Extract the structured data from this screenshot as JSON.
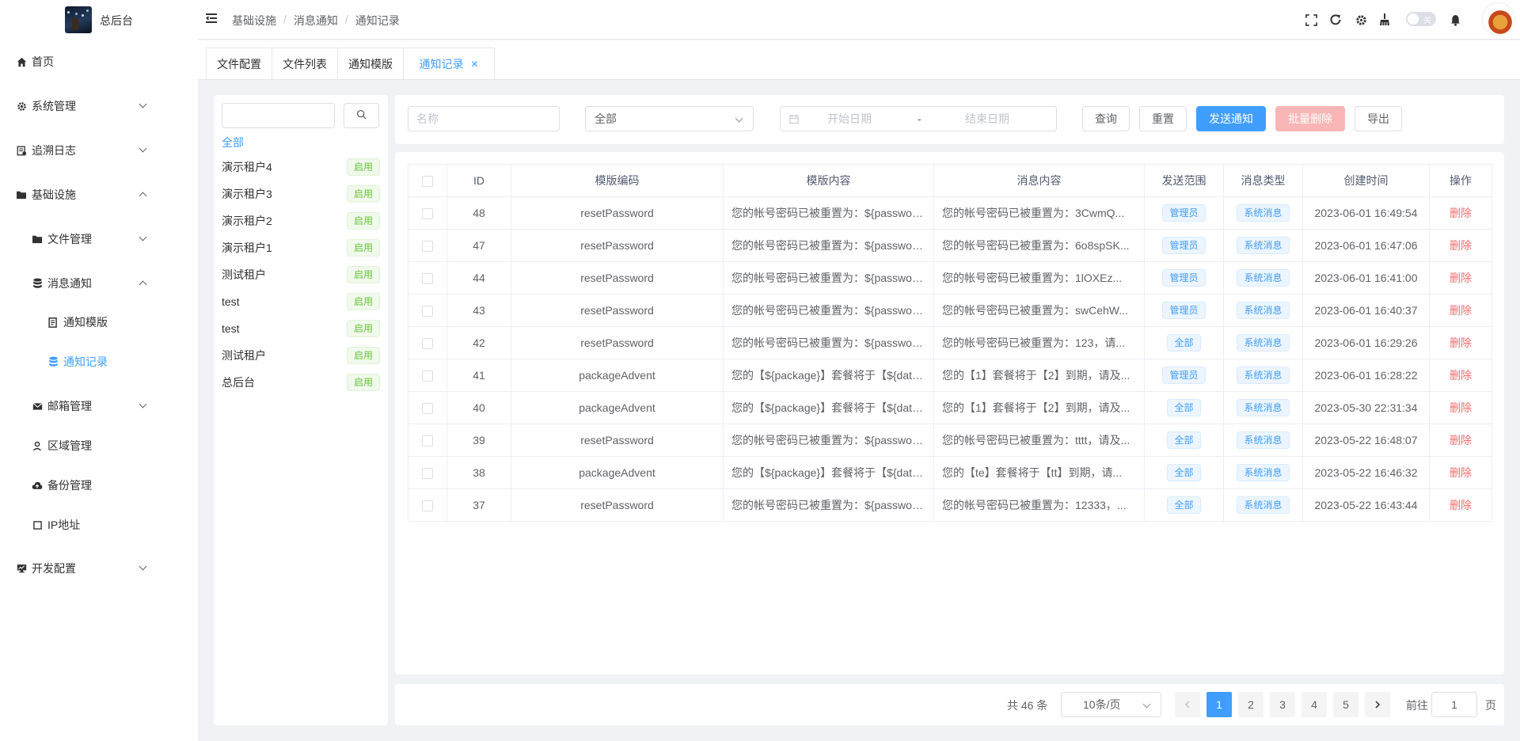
{
  "app": {
    "title": "总后台"
  },
  "sidebar": {
    "items": [
      {
        "label": "首页",
        "icon": "home-icon"
      },
      {
        "label": "系统管理",
        "icon": "gear-icon"
      },
      {
        "label": "追溯日志",
        "icon": "log-icon"
      },
      {
        "label": "基础设施",
        "icon": "folder-icon"
      },
      {
        "label": "文件管理",
        "icon": "folder-icon"
      },
      {
        "label": "消息通知",
        "icon": "database-icon"
      },
      {
        "label": "通知模版",
        "icon": "document-icon"
      },
      {
        "label": "通知记录",
        "icon": "database-icon"
      },
      {
        "label": "邮箱管理",
        "icon": "mail-icon"
      },
      {
        "label": "区域管理",
        "icon": "location-icon"
      },
      {
        "label": "备份管理",
        "icon": "cloud-upload-icon"
      },
      {
        "label": "IP地址",
        "icon": "square-icon"
      },
      {
        "label": "开发配置",
        "icon": "monitor-icon"
      }
    ]
  },
  "header": {
    "breadcrumb": [
      "基础设施",
      "消息通知",
      "通知记录"
    ],
    "toggle_text": "关"
  },
  "tabs": [
    "文件配置",
    "文件列表",
    "通知模版",
    "通知记录"
  ],
  "tree": {
    "all_label": "全部",
    "tenants": [
      {
        "name": "演示租户4",
        "status": "启用"
      },
      {
        "name": "演示租户3",
        "status": "启用"
      },
      {
        "name": "演示租户2",
        "status": "启用"
      },
      {
        "name": "演示租户1",
        "status": "启用"
      },
      {
        "name": "测试租户",
        "status": "启用"
      },
      {
        "name": "test",
        "status": "启用"
      },
      {
        "name": "test",
        "status": "启用"
      },
      {
        "name": "测试租户",
        "status": "启用"
      },
      {
        "name": "总后台",
        "status": "启用"
      }
    ]
  },
  "filters": {
    "name_placeholder": "名称",
    "type_value": "全部",
    "start_placeholder": "开始日期",
    "range_sep": "-",
    "end_placeholder": "结束日期",
    "btn_query": "查询",
    "btn_reset": "重置",
    "btn_send": "发送通知",
    "btn_batch_delete": "批量删除",
    "btn_export": "导出"
  },
  "table": {
    "headers": [
      "ID",
      "模版编码",
      "模版内容",
      "消息内容",
      "发送范围",
      "消息类型",
      "创建时间",
      "操作"
    ],
    "rows": [
      [
        "48",
        "resetPassword",
        "您的帐号密码已被重置为：${password}",
        "您的帐号密码已被重置为：3CwmQ...",
        "管理员",
        "系统消息",
        "2023-06-01 16:49:54",
        "删除"
      ],
      [
        "47",
        "resetPassword",
        "您的帐号密码已被重置为：${password}",
        "您的帐号密码已被重置为：6o8spSK...",
        "管理员",
        "系统消息",
        "2023-06-01 16:47:06",
        "删除"
      ],
      [
        "44",
        "resetPassword",
        "您的帐号密码已被重置为：${password}",
        "您的帐号密码已被重置为：1lOXEz...",
        "管理员",
        "系统消息",
        "2023-06-01 16:41:00",
        "删除"
      ],
      [
        "43",
        "resetPassword",
        "您的帐号密码已被重置为：${password}",
        "您的帐号密码已被重置为：swCehW...",
        "管理员",
        "系统消息",
        "2023-06-01 16:40:37",
        "删除"
      ],
      [
        "42",
        "resetPassword",
        "您的帐号密码已被重置为：${password}",
        "您的帐号密码已被重置为：123，请...",
        "全部",
        "系统消息",
        "2023-06-01 16:29:26",
        "删除"
      ],
      [
        "41",
        "packageAdvent",
        "您的【${package}】套餐将于【${date}】",
        "您的【1】套餐将于【2】到期，请及...",
        "管理员",
        "系统消息",
        "2023-06-01 16:28:22",
        "删除"
      ],
      [
        "40",
        "packageAdvent",
        "您的【${package}】套餐将于【${date}】",
        "您的【1】套餐将于【2】到期，请及...",
        "全部",
        "系统消息",
        "2023-05-30 22:31:34",
        "删除"
      ],
      [
        "39",
        "resetPassword",
        "您的帐号密码已被重置为：${password}",
        "您的帐号密码已被重置为：tttt，请及...",
        "全部",
        "系统消息",
        "2023-05-22 16:48:07",
        "删除"
      ],
      [
        "38",
        "packageAdvent",
        "您的【${package}】套餐将于【${date}】",
        "您的【te】套餐将于【tt】到期，请...",
        "全部",
        "系统消息",
        "2023-05-22 16:46:32",
        "删除"
      ],
      [
        "37",
        "resetPassword",
        "您的帐号密码已被重置为：${password}",
        "您的帐号密码已被重置为：12333，...",
        "全部",
        "系统消息",
        "2023-05-22 16:43:44",
        "删除"
      ]
    ]
  },
  "pagination": {
    "total": "共 46 条",
    "page_size": "10条/页",
    "pages": [
      "1",
      "2",
      "3",
      "4",
      "5"
    ],
    "current": "1",
    "goto_label": "前往",
    "goto_value": "1",
    "goto_unit": "页"
  },
  "colors": {
    "primary": "#409eff",
    "success": "#67c23a",
    "danger": "#f56c6c"
  }
}
